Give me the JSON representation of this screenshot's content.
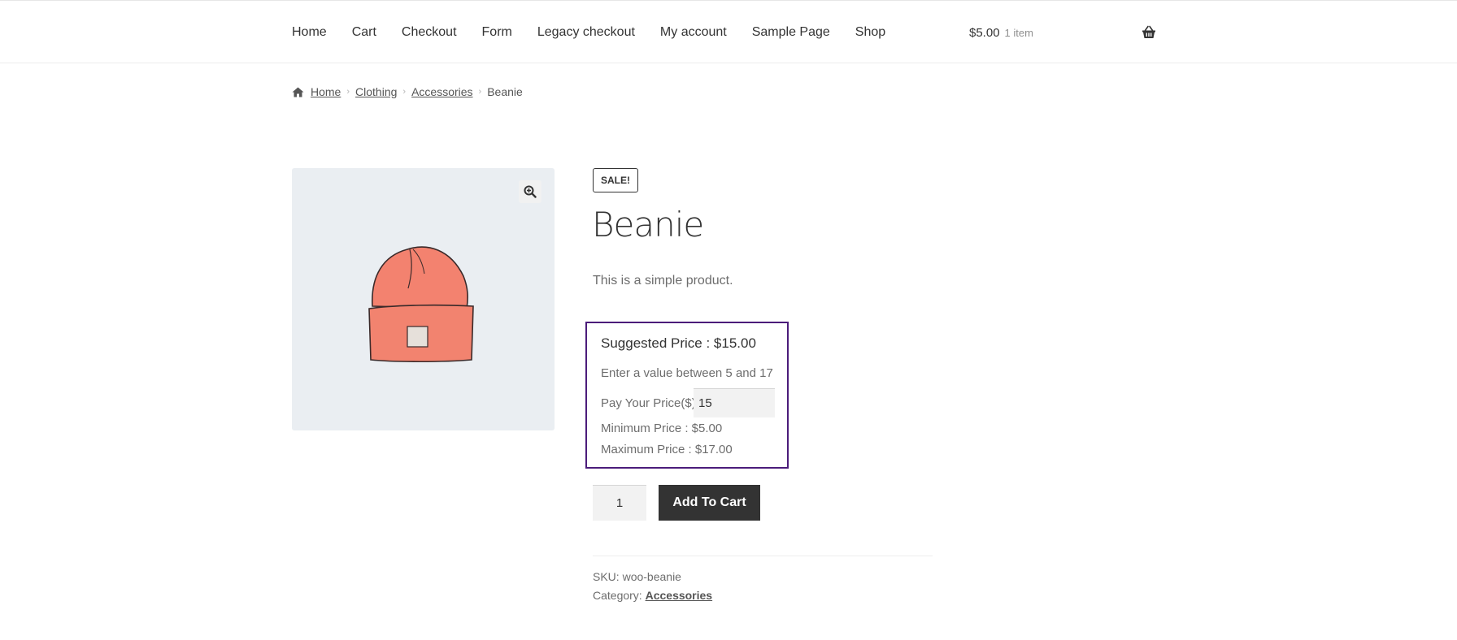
{
  "nav": {
    "items": [
      "Home",
      "Cart",
      "Checkout",
      "Form",
      "Legacy checkout",
      "My account",
      "Sample Page",
      "Shop"
    ]
  },
  "header_cart": {
    "total": "$5.00",
    "count": "1 item",
    "icon": "basket-icon"
  },
  "breadcrumb": {
    "home": "Home",
    "clothing": "Clothing",
    "accessories": "Accessories",
    "current": "Beanie"
  },
  "product": {
    "badge": "SALE!",
    "title": "Beanie",
    "short_description": "This is a simple product.",
    "image_icon": "zoom-icon"
  },
  "pay_your_price": {
    "suggested": "Suggested Price : $15.00",
    "range_hint": "Enter a value between 5 and 17",
    "label": "Pay Your Price($)",
    "value": "15",
    "minimum": "Minimum Price : $5.00",
    "maximum": "Maximum Price : $17.00",
    "border_color": "#4b1c7a"
  },
  "cart_form": {
    "quantity": "1",
    "add_label": "Add To Cart"
  },
  "meta": {
    "sku_label": "SKU:",
    "sku_value": "woo-beanie",
    "category_label": "Category:",
    "category_value": "Accessories"
  }
}
